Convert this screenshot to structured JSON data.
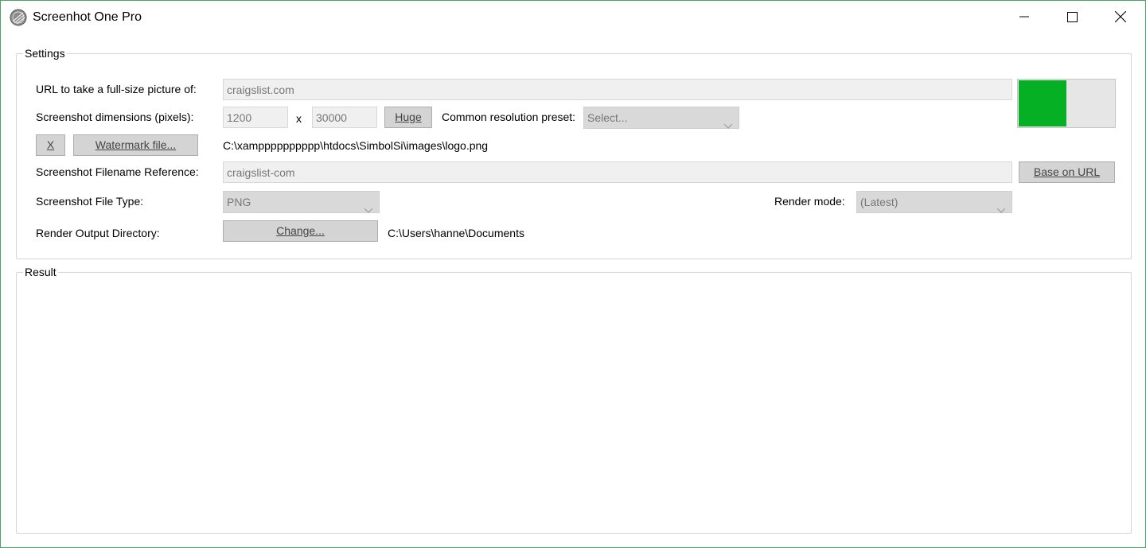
{
  "window": {
    "title": "Screenhot One Pro",
    "icons": {
      "app": "app-logo-icon",
      "minimize": "minimize-icon",
      "maximize": "maximize-icon",
      "close": "close-icon"
    }
  },
  "settings": {
    "legend": "Settings",
    "url": {
      "label": "URL to take a full-size picture of:",
      "value": "craigslist.com"
    },
    "dimensions": {
      "label": "Screenshot dimensions (pixels):",
      "width": "1200",
      "separator": "x",
      "height": "30000",
      "huge_button": "Huge",
      "preset_label": "Common resolution preset:",
      "preset_value": "Select..."
    },
    "watermark": {
      "clear_button": "X",
      "file_button": "Watermark file...",
      "path": "C:\\xampppppppppp\\htdocs\\SimbolSi\\images\\logo.png"
    },
    "filename": {
      "label": "Screenshot Filename Reference:",
      "value": "craigslist-com",
      "button": "Base on URL"
    },
    "file_type": {
      "label": "Screenshot File Type:",
      "value": "PNG"
    },
    "render_mode": {
      "label": "Render mode:",
      "value": "(Latest)"
    },
    "output_dir": {
      "label": "Render Output Directory:",
      "button": "Change...",
      "path": "C:\\Users\\hanne\\Documents"
    },
    "progress": {
      "fraction": 0.5,
      "color": "#06b025"
    }
  },
  "result": {
    "legend": "Result"
  }
}
